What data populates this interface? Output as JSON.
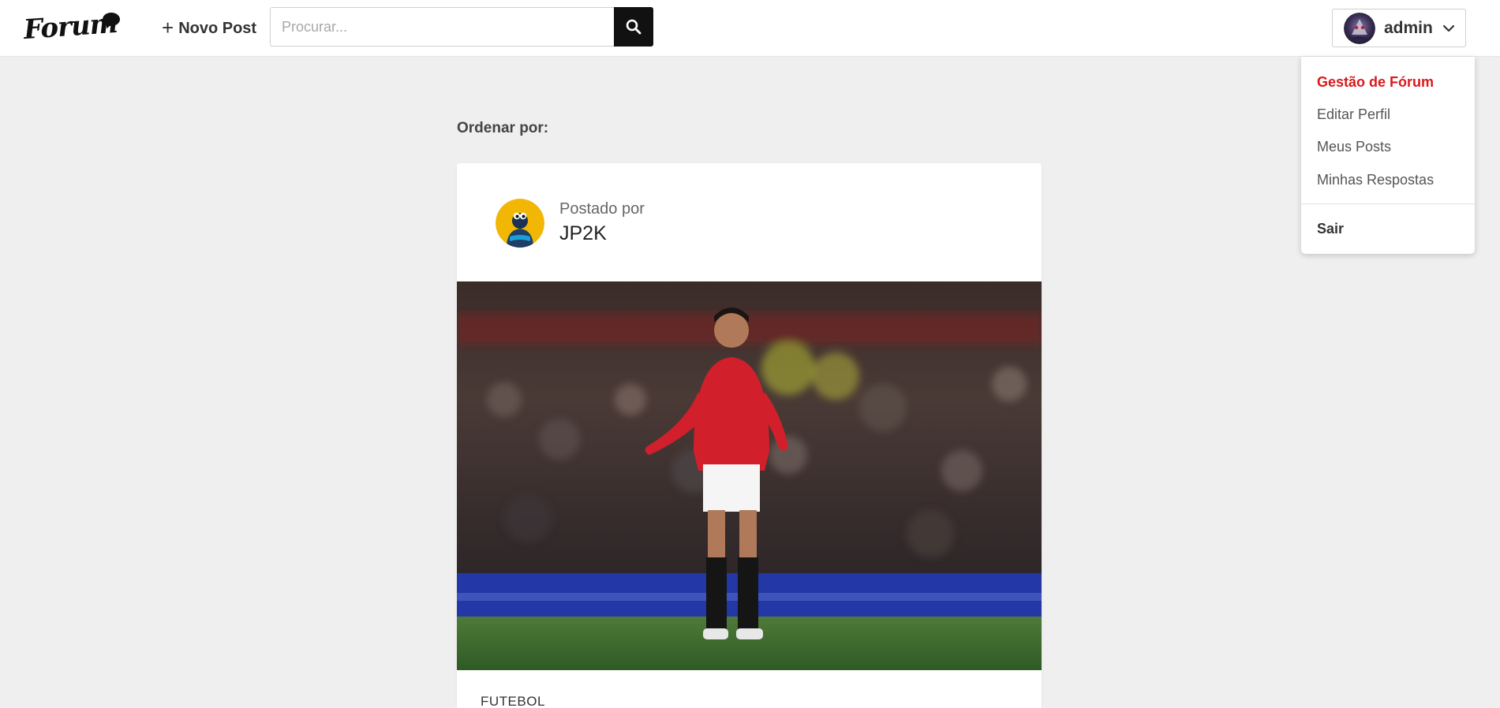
{
  "header": {
    "logo_text": "Forum",
    "new_post_label": "Novo Post",
    "search_placeholder": "Procurar...",
    "search_value": "",
    "user_name": "admin"
  },
  "user_menu": {
    "admin_item": "Gestão de Fórum",
    "items": [
      "Editar Perfil",
      "Meus Posts",
      "Minhas Respostas"
    ],
    "logout": "Sair"
  },
  "main": {
    "sort_label": "Ordenar por:",
    "post": {
      "posted_by_label": "Postado por",
      "author": "JP2K",
      "category": "FUTEBOL"
    }
  },
  "colors": {
    "accent": "#d9191c",
    "header_bg": "#ffffff",
    "page_bg": "#efefef",
    "search_button": "#111111"
  },
  "icons": [
    "forum-logo-icon",
    "plus-icon",
    "search-icon",
    "chevron-down-icon"
  ]
}
